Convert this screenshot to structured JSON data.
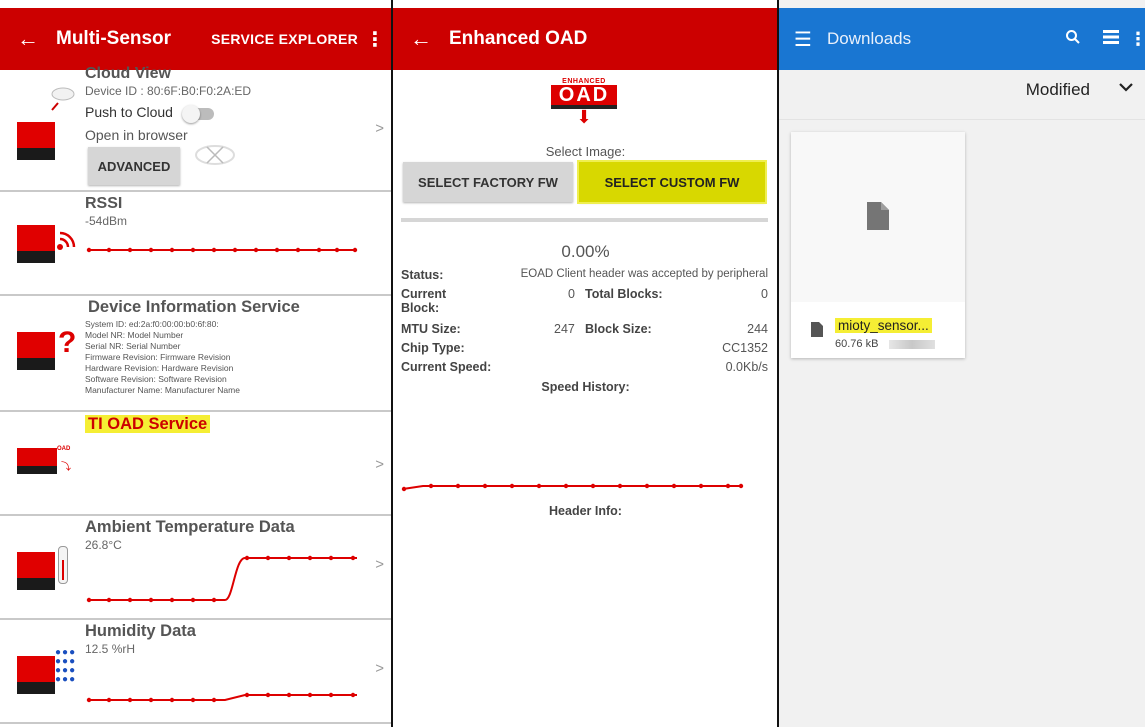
{
  "panel_multisensor": {
    "app_bar": {
      "title": "Multi-Sensor",
      "action": "SERVICE EXPLORER",
      "back_icon": "arrow-back-icon",
      "menu_icon": "more-vert-icon"
    },
    "cloud_view": {
      "title": "Cloud View",
      "device_id": "Device ID : 80:6F:B0:F0:2A:ED",
      "push_label": "Push to Cloud",
      "push_on": false,
      "browser_label": "Open in browser",
      "advanced_label": "ADVANCED"
    },
    "rssi": {
      "title": "RSSI",
      "value": "-54dBm",
      "history": [
        0,
        0,
        0,
        0,
        0,
        0,
        0,
        0,
        0,
        0,
        0,
        0,
        0,
        0
      ]
    },
    "device_info": {
      "title": "Device Information Service",
      "lines": [
        "System ID: ed:2a:f0:00:00:b0:6f:80:",
        "Model NR: Model Number",
        "Serial NR: Serial Number",
        "Firmware Revision: Firmware Revision",
        "Hardware Revision: Hardware Revision",
        "Software Revision: Software Revision",
        "Manufacturer Name: Manufacturer Name"
      ]
    },
    "ti_oad": {
      "title": "TI OAD Service"
    },
    "ambient_temp": {
      "title": "Ambient Temperature Data",
      "value": "26.8°C"
    },
    "humidity": {
      "title": "Humidity Data",
      "value": "12.5 %rH"
    },
    "chevron": ">"
  },
  "panel_oad": {
    "app_bar": {
      "title": "Enhanced OAD",
      "back_icon": "arrow-back-icon"
    },
    "logo_text": [
      "ENHANCED",
      "OAD"
    ],
    "select_image_label": "Select Image:",
    "btn_factory": "SELECT FACTORY FW",
    "btn_custom": "SELECT CUSTOM FW",
    "progress_fraction": 0.0,
    "percent": "0.00%",
    "status_label": "Status:",
    "status_value": "EOAD Client header was accepted by peripheral",
    "current_block_label": "Current Block:",
    "current_block_value": "0",
    "total_blocks_label": "Total Blocks:",
    "total_blocks_value": "0",
    "mtu_label": "MTU Size:",
    "mtu_value": "247",
    "block_size_label": "Block Size:",
    "block_size_value": "244",
    "chip_label": "Chip Type:",
    "chip_value": "CC1352",
    "speed_label": "Current Speed:",
    "speed_value": "0.0Kb/s",
    "speed_history_label": "Speed History:",
    "header_info_label": "Header Info:"
  },
  "panel_downloads": {
    "app_bar": {
      "title": "Downloads",
      "menu_icon": "hamburger-icon",
      "search_icon": "search-icon",
      "list_icon": "list-view-icon",
      "more_icon": "more-vert-icon"
    },
    "sort_label": "Modified",
    "file": {
      "name": "mioty_sensor...",
      "size": "60.76 kB"
    }
  },
  "colors": {
    "ti_red": "#cc0000",
    "blue": "#1976d2",
    "highlight": "#f5ee34",
    "custom_btn": "#d8d800"
  }
}
